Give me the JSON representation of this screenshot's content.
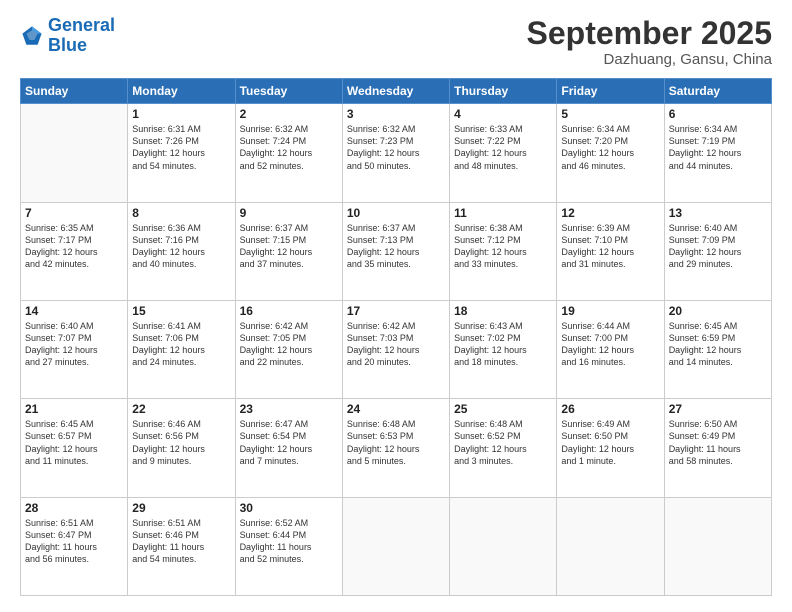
{
  "header": {
    "logo_line1": "General",
    "logo_line2": "Blue",
    "month": "September 2025",
    "location": "Dazhuang, Gansu, China"
  },
  "weekdays": [
    "Sunday",
    "Monday",
    "Tuesday",
    "Wednesday",
    "Thursday",
    "Friday",
    "Saturday"
  ],
  "weeks": [
    [
      {
        "day": "",
        "text": ""
      },
      {
        "day": "1",
        "text": "Sunrise: 6:31 AM\nSunset: 7:26 PM\nDaylight: 12 hours\nand 54 minutes."
      },
      {
        "day": "2",
        "text": "Sunrise: 6:32 AM\nSunset: 7:24 PM\nDaylight: 12 hours\nand 52 minutes."
      },
      {
        "day": "3",
        "text": "Sunrise: 6:32 AM\nSunset: 7:23 PM\nDaylight: 12 hours\nand 50 minutes."
      },
      {
        "day": "4",
        "text": "Sunrise: 6:33 AM\nSunset: 7:22 PM\nDaylight: 12 hours\nand 48 minutes."
      },
      {
        "day": "5",
        "text": "Sunrise: 6:34 AM\nSunset: 7:20 PM\nDaylight: 12 hours\nand 46 minutes."
      },
      {
        "day": "6",
        "text": "Sunrise: 6:34 AM\nSunset: 7:19 PM\nDaylight: 12 hours\nand 44 minutes."
      }
    ],
    [
      {
        "day": "7",
        "text": "Sunrise: 6:35 AM\nSunset: 7:17 PM\nDaylight: 12 hours\nand 42 minutes."
      },
      {
        "day": "8",
        "text": "Sunrise: 6:36 AM\nSunset: 7:16 PM\nDaylight: 12 hours\nand 40 minutes."
      },
      {
        "day": "9",
        "text": "Sunrise: 6:37 AM\nSunset: 7:15 PM\nDaylight: 12 hours\nand 37 minutes."
      },
      {
        "day": "10",
        "text": "Sunrise: 6:37 AM\nSunset: 7:13 PM\nDaylight: 12 hours\nand 35 minutes."
      },
      {
        "day": "11",
        "text": "Sunrise: 6:38 AM\nSunset: 7:12 PM\nDaylight: 12 hours\nand 33 minutes."
      },
      {
        "day": "12",
        "text": "Sunrise: 6:39 AM\nSunset: 7:10 PM\nDaylight: 12 hours\nand 31 minutes."
      },
      {
        "day": "13",
        "text": "Sunrise: 6:40 AM\nSunset: 7:09 PM\nDaylight: 12 hours\nand 29 minutes."
      }
    ],
    [
      {
        "day": "14",
        "text": "Sunrise: 6:40 AM\nSunset: 7:07 PM\nDaylight: 12 hours\nand 27 minutes."
      },
      {
        "day": "15",
        "text": "Sunrise: 6:41 AM\nSunset: 7:06 PM\nDaylight: 12 hours\nand 24 minutes."
      },
      {
        "day": "16",
        "text": "Sunrise: 6:42 AM\nSunset: 7:05 PM\nDaylight: 12 hours\nand 22 minutes."
      },
      {
        "day": "17",
        "text": "Sunrise: 6:42 AM\nSunset: 7:03 PM\nDaylight: 12 hours\nand 20 minutes."
      },
      {
        "day": "18",
        "text": "Sunrise: 6:43 AM\nSunset: 7:02 PM\nDaylight: 12 hours\nand 18 minutes."
      },
      {
        "day": "19",
        "text": "Sunrise: 6:44 AM\nSunset: 7:00 PM\nDaylight: 12 hours\nand 16 minutes."
      },
      {
        "day": "20",
        "text": "Sunrise: 6:45 AM\nSunset: 6:59 PM\nDaylight: 12 hours\nand 14 minutes."
      }
    ],
    [
      {
        "day": "21",
        "text": "Sunrise: 6:45 AM\nSunset: 6:57 PM\nDaylight: 12 hours\nand 11 minutes."
      },
      {
        "day": "22",
        "text": "Sunrise: 6:46 AM\nSunset: 6:56 PM\nDaylight: 12 hours\nand 9 minutes."
      },
      {
        "day": "23",
        "text": "Sunrise: 6:47 AM\nSunset: 6:54 PM\nDaylight: 12 hours\nand 7 minutes."
      },
      {
        "day": "24",
        "text": "Sunrise: 6:48 AM\nSunset: 6:53 PM\nDaylight: 12 hours\nand 5 minutes."
      },
      {
        "day": "25",
        "text": "Sunrise: 6:48 AM\nSunset: 6:52 PM\nDaylight: 12 hours\nand 3 minutes."
      },
      {
        "day": "26",
        "text": "Sunrise: 6:49 AM\nSunset: 6:50 PM\nDaylight: 12 hours\nand 1 minute."
      },
      {
        "day": "27",
        "text": "Sunrise: 6:50 AM\nSunset: 6:49 PM\nDaylight: 11 hours\nand 58 minutes."
      }
    ],
    [
      {
        "day": "28",
        "text": "Sunrise: 6:51 AM\nSunset: 6:47 PM\nDaylight: 11 hours\nand 56 minutes."
      },
      {
        "day": "29",
        "text": "Sunrise: 6:51 AM\nSunset: 6:46 PM\nDaylight: 11 hours\nand 54 minutes."
      },
      {
        "day": "30",
        "text": "Sunrise: 6:52 AM\nSunset: 6:44 PM\nDaylight: 11 hours\nand 52 minutes."
      },
      {
        "day": "",
        "text": ""
      },
      {
        "day": "",
        "text": ""
      },
      {
        "day": "",
        "text": ""
      },
      {
        "day": "",
        "text": ""
      }
    ]
  ]
}
